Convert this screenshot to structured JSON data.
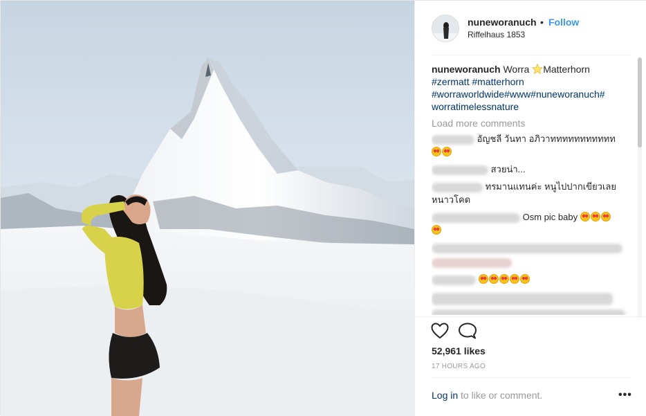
{
  "post": {
    "username": "nuneworanuch",
    "separator": "•",
    "follow_label": "Follow",
    "location": "Riffelhaus 1853"
  },
  "caption": {
    "username": "nuneworanuch",
    "text_before": "Worra ",
    "text_after": "Matterhorn",
    "hashtags": [
      "#zermatt #matterhorn",
      "#worraworldwide#www#nuneworanuch#",
      "worratimelessnature"
    ]
  },
  "load_more_label": "Load more comments",
  "comments": [
    {
      "text": "อัญชลี วันทา อภิวาททททททททททท"
    },
    {
      "text": "สวยน่า..."
    },
    {
      "text": "ทรมานแทนค่ะ หนูไปปากเขียวเลย",
      "text2": "หนาวโคด"
    },
    {
      "text": "Osm pic baby"
    }
  ],
  "likes": "52,961 likes",
  "timestamp": "17 HOURS AGO",
  "login": {
    "link": "Log in",
    "rest": " to like or comment."
  },
  "more_label": "•••",
  "icons": {
    "heart": "heart-icon",
    "comment": "comment-icon",
    "star": "star-icon",
    "options": "more-options-icon"
  },
  "colors": {
    "link_blue": "#3897f0",
    "hashtag": "#003569",
    "muted": "#999999"
  }
}
